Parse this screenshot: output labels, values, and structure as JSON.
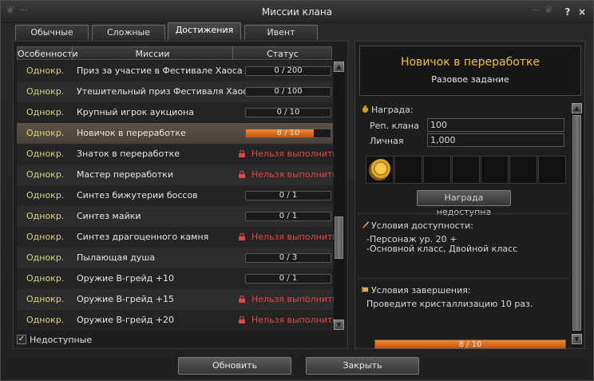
{
  "window": {
    "title": "Миссии клана",
    "help_label": "?",
    "close_label": "×"
  },
  "tabs": [
    {
      "label": "Обычные",
      "active": false
    },
    {
      "label": "Сложные",
      "active": false
    },
    {
      "label": "Достижения",
      "active": true
    },
    {
      "label": "Ивент",
      "active": false
    }
  ],
  "columns": {
    "features": "Особенности",
    "missions": "Миссии",
    "status": "Статус"
  },
  "missions": [
    {
      "type": "Однокр.",
      "name": "Приз за участие в Фестивале Хаоса",
      "status": "0 / 200",
      "progress": 0,
      "locked": false,
      "selected": false
    },
    {
      "type": "Однокр.",
      "name": "Утешительный приз Фестиваля Хаос",
      "status": "0 / 100",
      "progress": 0,
      "locked": false,
      "selected": false
    },
    {
      "type": "Однокр.",
      "name": "Крупный игрок аукциона",
      "status": "0 / 10",
      "progress": 0,
      "locked": false,
      "selected": false
    },
    {
      "type": "Однокр.",
      "name": "Новичок в переработке",
      "status": "8 / 10",
      "progress": 0.8,
      "locked": false,
      "selected": true
    },
    {
      "type": "Однокр.",
      "name": "Знаток в переработке",
      "status": "Нельзя выполнить",
      "progress": 0,
      "locked": true,
      "selected": false
    },
    {
      "type": "Однокр.",
      "name": "Мастер переработки",
      "status": "Нельзя выполнить",
      "progress": 0,
      "locked": true,
      "selected": false
    },
    {
      "type": "Однокр.",
      "name": "Синтез бижутерии боссов",
      "status": "0 / 1",
      "progress": 0,
      "locked": false,
      "selected": false
    },
    {
      "type": "Однокр.",
      "name": "Синтез майки",
      "status": "0 / 1",
      "progress": 0,
      "locked": false,
      "selected": false
    },
    {
      "type": "Однокр.",
      "name": "Синтез драгоценного камня",
      "status": "Нельзя выполнить",
      "progress": 0,
      "locked": true,
      "selected": false
    },
    {
      "type": "Однокр.",
      "name": "Пылающая душа",
      "status": "0 / 3",
      "progress": 0,
      "locked": false,
      "selected": false
    },
    {
      "type": "Однокр.",
      "name": "Оружие B-грейд +10",
      "status": "0 / 1",
      "progress": 0,
      "locked": false,
      "selected": false
    },
    {
      "type": "Однокр.",
      "name": "Оружие B-грейд +15",
      "status": "Нельзя выполнить",
      "progress": 0,
      "locked": true,
      "selected": false
    },
    {
      "type": "Однокр.",
      "name": "Оружие B-грейд +20",
      "status": "Нельзя выполнить",
      "progress": 0,
      "locked": true,
      "selected": false
    }
  ],
  "unavailable": {
    "label": "Недоступные",
    "checked": true,
    "check_mark": "✓"
  },
  "detail": {
    "title": "Новичок в переработке",
    "subtitle": "Разовое задание",
    "reward_header": "Награда:",
    "rep_label": "Реп. клана",
    "rep_value": "100",
    "personal_label": "Личная",
    "personal_value": "1,000",
    "reward_button": "Награда недоступна",
    "availability_header": "Условия доступности:",
    "availability_lines": [
      "-Персонаж  ур. 20  +",
      "-Основной класс, Двойной класс"
    ],
    "completion_header": "Условия завершения:",
    "completion_text": "Проведите кристаллизацию 10 раз.",
    "progress_text": "8 / 10",
    "progress": 0.8
  },
  "buttons": {
    "refresh": "Обновить",
    "close": "Закрыть"
  },
  "colors": {
    "accent_orange": "#e07020",
    "mission_type": "#dcd48a",
    "locked_red": "#e04848",
    "title_gold": "#f0c040"
  }
}
